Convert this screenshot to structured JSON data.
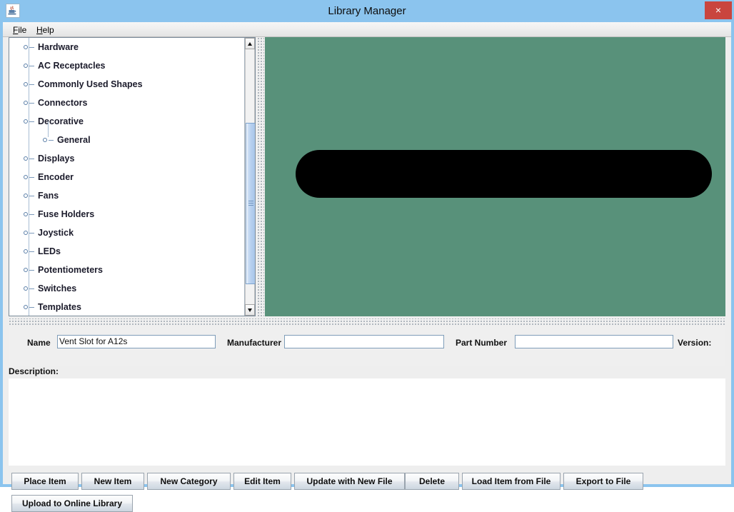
{
  "window": {
    "title": "Library Manager",
    "app_icon": "java-coffee-cup-icon",
    "close_label": "×"
  },
  "menubar": {
    "items": [
      {
        "label": "File",
        "mnemonic": "F"
      },
      {
        "label": "Help",
        "mnemonic": "H"
      }
    ]
  },
  "tree": {
    "nodes": [
      {
        "label": "Hardware",
        "depth": 1,
        "expanded": false
      },
      {
        "label": "AC Receptacles",
        "depth": 1,
        "expanded": false
      },
      {
        "label": "Commonly Used Shapes",
        "depth": 1,
        "expanded": false
      },
      {
        "label": "Connectors",
        "depth": 1,
        "expanded": false
      },
      {
        "label": "Decorative",
        "depth": 1,
        "expanded": true
      },
      {
        "label": "General",
        "depth": 2,
        "expanded": false
      },
      {
        "label": "Displays",
        "depth": 1,
        "expanded": false
      },
      {
        "label": "Encoder",
        "depth": 1,
        "expanded": false
      },
      {
        "label": "Fans",
        "depth": 1,
        "expanded": false
      },
      {
        "label": "Fuse Holders",
        "depth": 1,
        "expanded": false
      },
      {
        "label": "Joystick",
        "depth": 1,
        "expanded": false
      },
      {
        "label": "LEDs",
        "depth": 1,
        "expanded": false
      },
      {
        "label": "Potentiometers",
        "depth": 1,
        "expanded": false
      },
      {
        "label": "Switches",
        "depth": 1,
        "expanded": false
      },
      {
        "label": "Templates",
        "depth": 1,
        "expanded": false
      }
    ],
    "scrollbar": {
      "up_arrow": "scroll-up-arrow",
      "down_arrow": "scroll-down-arrow"
    }
  },
  "preview": {
    "background_color": "#58917a",
    "shape_color": "#000000",
    "shape": "rounded-rectangle"
  },
  "details": {
    "name_label": "Name",
    "name_value": "Vent Slot for A12s",
    "name_placeholder": "",
    "manufacturer_label": "Manufacturer",
    "manufacturer_value": "",
    "manufacturer_placeholder": "",
    "part_number_label": "Part Number",
    "part_number_value": "",
    "part_number_placeholder": "",
    "version_label": "Version:"
  },
  "description": {
    "label": "Description:",
    "value": "",
    "placeholder": ""
  },
  "actions": [
    "Place Item",
    "New Item",
    "New Category",
    "Edit Item",
    "Update with New File",
    "Delete",
    "Load Item from File",
    "Export to File",
    "Upload to Online Library"
  ]
}
